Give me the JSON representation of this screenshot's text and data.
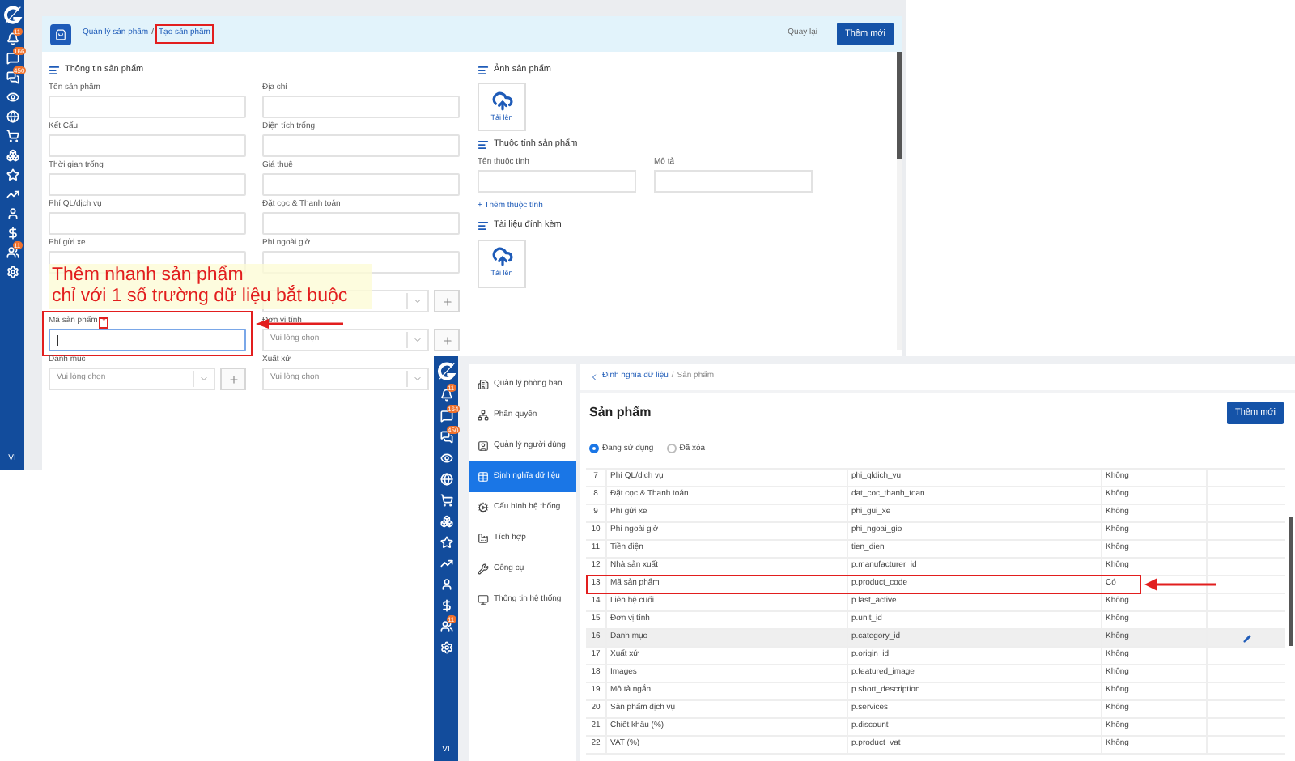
{
  "product_form": {
    "sidebar": {
      "items": [
        {
          "kind": "bell",
          "badge": "11"
        },
        {
          "kind": "chat",
          "badge": "166"
        },
        {
          "kind": "chats",
          "badge": "450"
        },
        {
          "kind": "eye"
        },
        {
          "kind": "globe"
        },
        {
          "kind": "cart"
        },
        {
          "kind": "boxes"
        },
        {
          "kind": "star"
        },
        {
          "kind": "chart"
        },
        {
          "kind": "user"
        },
        {
          "kind": "dollar"
        },
        {
          "kind": "users",
          "badge": "11"
        },
        {
          "kind": "settings"
        }
      ],
      "language": "VI"
    },
    "breadcrumb": [
      {
        "label": "Quản lý sản phẩm",
        "highlighted": false
      },
      {
        "label": "Tạo sản phẩm",
        "highlighted": true
      }
    ],
    "breadcrumb_separator": "/",
    "back_link": "Quay lại",
    "add_button": "Thêm mới",
    "info_section": {
      "title": "Thông tin sản phẩm",
      "rows": [
        {
          "left": {
            "label": "Tên sản phẩm",
            "kind": "text",
            "focused": false,
            "highlighted": false
          },
          "right": {
            "label": "Địa chỉ",
            "kind": "text",
            "focused": false,
            "highlighted": false
          }
        },
        {
          "left": {
            "label": "Kết Cấu",
            "kind": "text",
            "focused": false,
            "highlighted": false
          },
          "right": {
            "label": "Diện tích trống",
            "kind": "text",
            "focused": false,
            "highlighted": false
          }
        },
        {
          "left": {
            "label": "Thời gian trống",
            "kind": "text",
            "focused": false,
            "highlighted": false
          },
          "right": {
            "label": "Giá thuê",
            "kind": "text",
            "focused": false,
            "highlighted": false
          }
        },
        {
          "left": {
            "label": "Phí QL/dịch vụ",
            "kind": "text",
            "focused": false,
            "highlighted": false
          },
          "right": {
            "label": "Đặt cọc & Thanh toán",
            "kind": "text",
            "focused": false,
            "highlighted": false
          }
        },
        {
          "left": {
            "label": "Phí gửi xe",
            "kind": "text",
            "focused": false,
            "highlighted": false
          },
          "right": {
            "label": "Phí ngoài giờ",
            "kind": "text",
            "focused": false,
            "highlighted": false
          }
        },
        {
          "right": {
            "kind": "select_with_add",
            "focused": false,
            "highlighted": false
          }
        },
        {
          "left": {
            "label": "Mã sản phẩm",
            "required_mark": "*",
            "kind": "text",
            "focused": true,
            "highlighted": true
          },
          "right": {
            "label": "Đơn vị tính",
            "kind": "select_with_add",
            "placeholder": "Vui lòng chọn",
            "focused": false,
            "highlighted": false
          }
        },
        {
          "left": {
            "label": "Danh mục",
            "kind": "select_with_add",
            "placeholder": "Vui lòng chọn",
            "focused": false,
            "highlighted": false
          },
          "right": {
            "label": "Xuất xứ",
            "kind": "select",
            "placeholder": "Vui lòng chọn",
            "focused": false,
            "highlighted": false
          }
        }
      ]
    },
    "image_section": {
      "title": "Ảnh sản phẩm",
      "upload": "Tải lên"
    },
    "attribute_section": {
      "title": "Thuộc tính sản phẩm",
      "fields": [
        {
          "label": "Tên thuộc tính"
        },
        {
          "label": "Mô tả"
        }
      ],
      "add_link": "+ Thêm thuộc tính"
    },
    "attachment_section": {
      "title": "Tài liệu đính kèm",
      "upload": "Tải lên"
    }
  },
  "annotation": {
    "lines": [
      "Thêm nhanh sản phẩm",
      "chỉ với 1 số trường dữ liệu bắt buộc"
    ]
  },
  "data_settings": {
    "sidebar": {
      "items": [
        {
          "kind": "bell",
          "badge": "11"
        },
        {
          "kind": "chat",
          "badge": "164"
        },
        {
          "kind": "chats",
          "badge": "450"
        },
        {
          "kind": "eye"
        },
        {
          "kind": "globe"
        },
        {
          "kind": "cart"
        },
        {
          "kind": "boxes"
        },
        {
          "kind": "star"
        },
        {
          "kind": "chart"
        },
        {
          "kind": "user"
        },
        {
          "kind": "dollar"
        },
        {
          "kind": "users",
          "badge": "11"
        },
        {
          "kind": "settings"
        }
      ],
      "language": "VI"
    },
    "menu": [
      {
        "label": "Quản lý phòng ban",
        "selected": false
      },
      {
        "label": "Phân quyền",
        "selected": false
      },
      {
        "label": "Quản lý người dùng",
        "selected": false
      },
      {
        "label": "Định nghĩa dữ liệu",
        "selected": true
      },
      {
        "label": "Cấu hình hệ thống",
        "selected": false
      },
      {
        "label": "Tích hợp",
        "selected": false
      },
      {
        "label": "Công cụ",
        "selected": false
      },
      {
        "label": "Thông tin hệ thống",
        "selected": false
      }
    ],
    "breadcrumb": {
      "parent": "Định nghĩa dữ liệu",
      "separator": "/",
      "current": "Sản phẩm"
    },
    "title": "Sản phẩm",
    "add_button": "Thêm mới",
    "filters": [
      {
        "label": "Đang sử dụng",
        "selected": true
      },
      {
        "label": "Đã xóa",
        "selected": false
      }
    ],
    "rows": [
      {
        "no": "7",
        "name": "Phí QL/dịch vụ",
        "code": "phi_qldich_vu",
        "required": "Không",
        "hovered": false,
        "marked": false
      },
      {
        "no": "8",
        "name": "Đặt cọc & Thanh toán",
        "code": "dat_coc_thanh_toan",
        "required": "Không",
        "hovered": false,
        "marked": false
      },
      {
        "no": "9",
        "name": "Phí gửi xe",
        "code": "phi_gui_xe",
        "required": "Không",
        "hovered": false,
        "marked": false
      },
      {
        "no": "10",
        "name": "Phí ngoài giờ",
        "code": "phi_ngoai_gio",
        "required": "Không",
        "hovered": false,
        "marked": false
      },
      {
        "no": "11",
        "name": "Tiền điện",
        "code": "tien_dien",
        "required": "Không",
        "hovered": false,
        "marked": false
      },
      {
        "no": "12",
        "name": "Nhà sản xuất",
        "code": "p.manufacturer_id",
        "required": "Không",
        "hovered": false,
        "marked": false
      },
      {
        "no": "13",
        "name": "Mã sản phẩm",
        "code": "p.product_code",
        "required": "Có",
        "hovered": false,
        "marked": true
      },
      {
        "no": "14",
        "name": "Liên hệ cuối",
        "code": "p.last_active",
        "required": "Không",
        "hovered": false,
        "marked": false
      },
      {
        "no": "15",
        "name": "Đơn vị tính",
        "code": "p.unit_id",
        "required": "Không",
        "hovered": false,
        "marked": false
      },
      {
        "no": "16",
        "name": "Danh mục",
        "code": "p.category_id",
        "required": "Không",
        "hovered": true,
        "marked": false
      },
      {
        "no": "17",
        "name": "Xuất xứ",
        "code": "p.origin_id",
        "required": "Không",
        "hovered": false,
        "marked": false
      },
      {
        "no": "18",
        "name": "Images",
        "code": "p.featured_image",
        "required": "Không",
        "hovered": false,
        "marked": false
      },
      {
        "no": "19",
        "name": "Mô tả ngắn",
        "code": "p.short_description",
        "required": "Không",
        "hovered": false,
        "marked": false
      },
      {
        "no": "20",
        "name": "Sản phẩm dịch vụ",
        "code": "p.services",
        "required": "Không",
        "hovered": false,
        "marked": false
      },
      {
        "no": "21",
        "name": "Chiết khấu (%)",
        "code": "p.discount",
        "required": "Không",
        "hovered": false,
        "marked": false
      },
      {
        "no": "22",
        "name": "VAT (%)",
        "code": "p.product_vat",
        "required": "Không",
        "hovered": false,
        "marked": false
      }
    ]
  }
}
